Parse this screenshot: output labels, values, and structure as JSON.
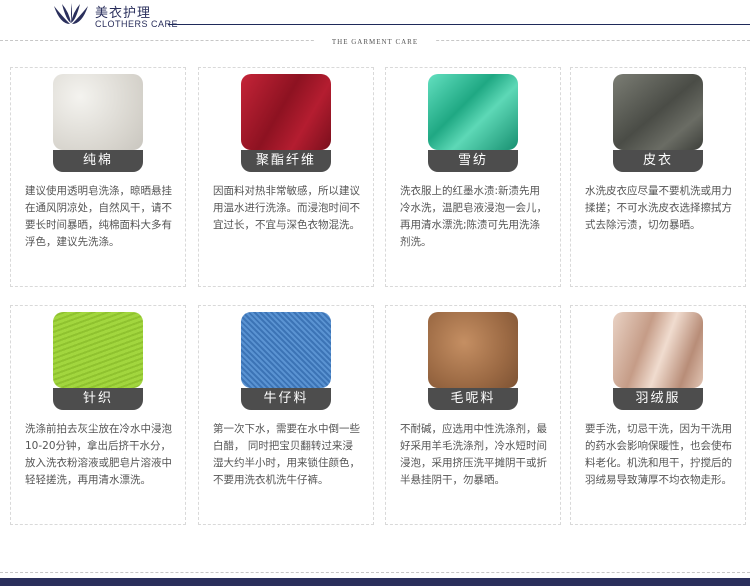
{
  "header": {
    "brand_cn": "美衣护理",
    "brand_en": "CLOTHERS CARE",
    "subtitle": "THE GARMENT CARE"
  },
  "cards": [
    {
      "label": "纯棉",
      "swatch_color": "#e8e6e1",
      "desc": "建议使用透明皂洗涤，晾晒悬挂在通风阴凉处，自然风干，请不要长时间暴晒，纯棉面料大多有浮色，建议先洗涤。"
    },
    {
      "label": "聚酯纤维",
      "swatch_color": "#a8182b",
      "desc": "因面料对热非常敏感，所以建议用温水进行洗涤。而浸泡时间不宜过长，不宜与深色衣物混洗。"
    },
    {
      "label": "雪纺",
      "swatch_color": "#37c2a0",
      "desc": "洗衣服上的红墨水渍:新渍先用冷水洗，温肥皂液浸泡一会儿，再用清水漂洗;陈渍可先用洗涤剂洗。"
    },
    {
      "label": "皮衣",
      "swatch_color": "#5d5f58",
      "desc": "水洗皮衣应尽量不要机洗或用力揉搓；不可水洗皮衣选择擦拭方式去除污渍，切勿暴晒。"
    },
    {
      "label": "针织",
      "swatch_color": "#98cc38",
      "desc": "洗涤前拍去灰尘放在冷水中浸泡10-20分钟，拿出后挤干水分， 放入洗衣粉溶液或肥皂片溶液中轻轻搓洗，再用清水漂洗。"
    },
    {
      "label": "牛仔料",
      "swatch_color": "#4b83c5",
      "desc": "第一次下水，需要在水中倒一些白醋， 同时把宝贝翻转过来浸湿大约半小时，用来锁住颜色，不要用洗衣机洗牛仔裤。"
    },
    {
      "label": "毛呢料",
      "swatch_color": "#b07a52",
      "desc": "不耐碱，应选用中性洗涤剂，最好采用羊毛洗涤剂，冷水短时间浸泡，采用挤压洗平摊阴干或折半悬挂阴干，勿暴晒。"
    },
    {
      "label": "羽绒服",
      "swatch_color": "#d8b8a7",
      "desc": "要手洗，切忌干洗，因为干洗用的药水会影响保暖性，也会使布料老化。机洗和甩干，拧搅后的羽绒易导致薄厚不均衣物走形。"
    }
  ]
}
